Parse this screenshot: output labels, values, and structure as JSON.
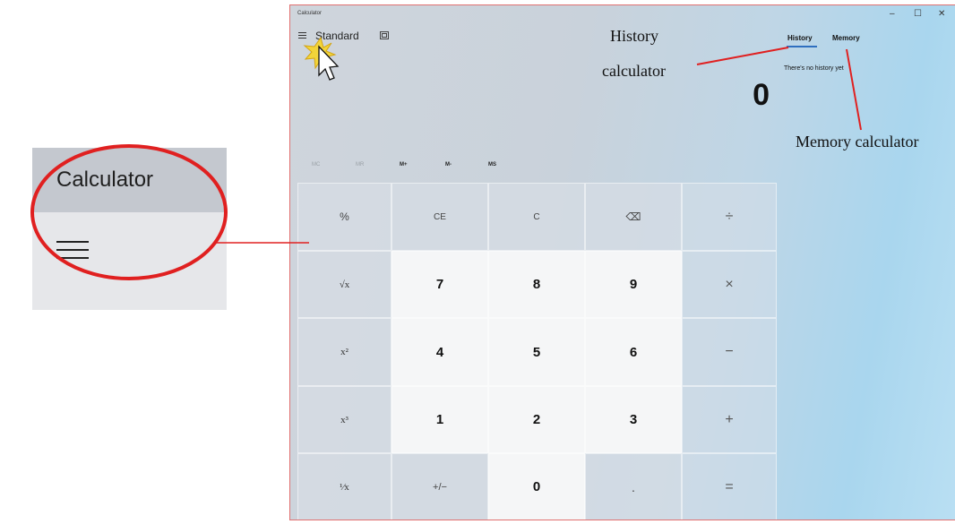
{
  "inset": {
    "title": "Calculator",
    "menu_icon": "hamburger-icon"
  },
  "window": {
    "title": "Calculator",
    "controls": {
      "minimize": "–",
      "maximize": "☐",
      "close": "✕"
    },
    "mode": "Standard",
    "tabs": {
      "history": "History",
      "memory": "Memory"
    },
    "history_empty": "There's no history yet",
    "display_value": "0",
    "memory_buttons": [
      "MC",
      "MR",
      "M+",
      "M-",
      "MS"
    ],
    "keys": [
      [
        "%",
        "CE",
        "C",
        "⌫",
        "÷"
      ],
      [
        "√x",
        "7",
        "8",
        "9",
        "×"
      ],
      [
        "x²",
        "4",
        "5",
        "6",
        "−"
      ],
      [
        "x³",
        "1",
        "2",
        "3",
        "+"
      ],
      [
        "¹⁄x",
        "+/−",
        "0",
        ".",
        "="
      ]
    ]
  },
  "annotations": {
    "history_line1": "History",
    "history_line2": "calculator",
    "memory": "Memory calculator"
  },
  "colors": {
    "annotation_red": "#e02020",
    "tab_underline": "#2f6fbf"
  }
}
